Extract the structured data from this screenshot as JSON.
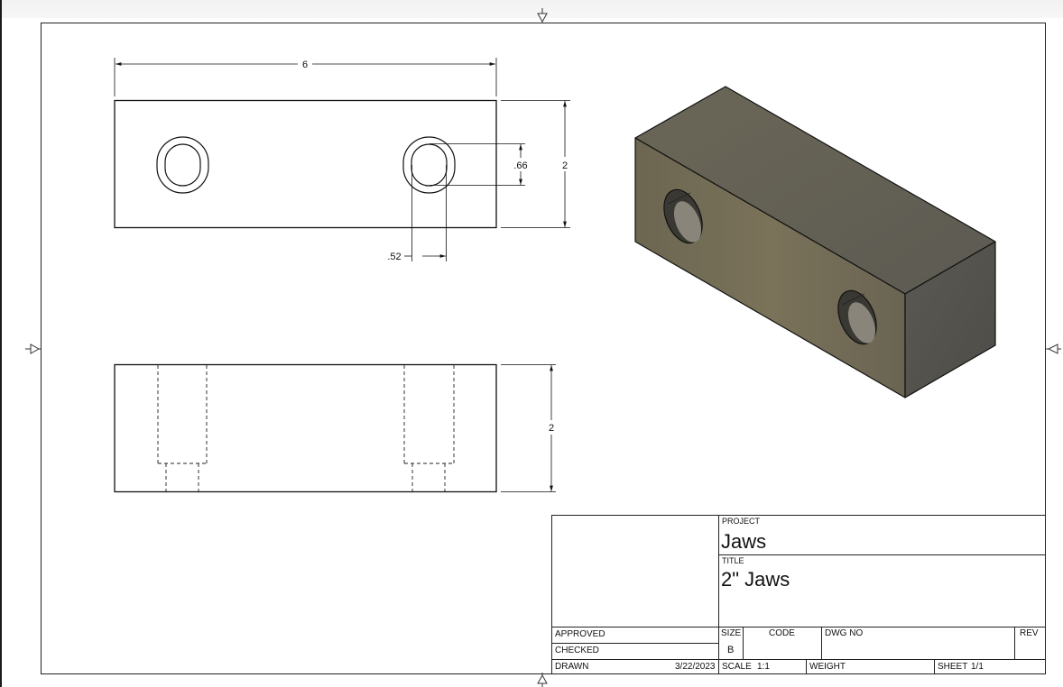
{
  "drawing": {
    "dimensions": {
      "overall_length": "6",
      "height_front": "2",
      "slot_height": ".66",
      "slot_width": ".52",
      "height_side": "2"
    },
    "part_color": "#6b6656"
  },
  "title_block": {
    "project_label": "PROJECT",
    "project_value": "Jaws",
    "title_label": "TITLE",
    "title_value": "2\"  Jaws",
    "approved_label": "APPROVED",
    "checked_label": "CHECKED",
    "drawn_label": "DRAWN",
    "drawn_date": "3/22/2023",
    "size_label": "SIZE",
    "size_value": "B",
    "code_label": "CODE",
    "dwg_no_label": "DWG NO",
    "rev_label": "REV",
    "scale_label": "SCALE",
    "scale_value": "1:1",
    "weight_label": "WEIGHT",
    "sheet_label": "SHEET",
    "sheet_value": "1/1"
  }
}
